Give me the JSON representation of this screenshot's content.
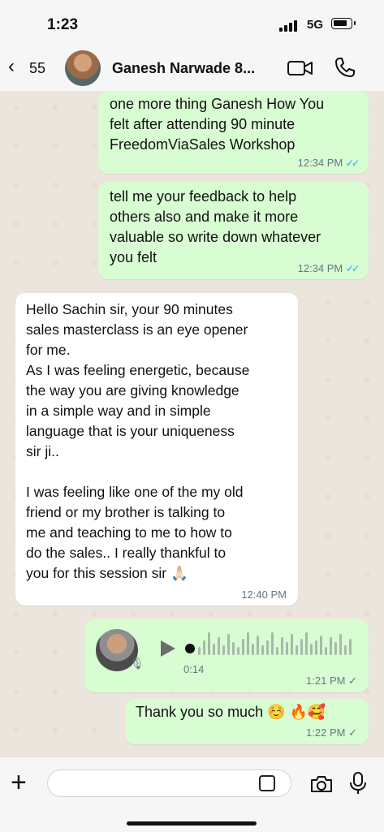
{
  "status": {
    "time": "1:23",
    "network": "5G"
  },
  "header": {
    "back_count": "55",
    "contact": "Ganesh Narwade 8..."
  },
  "messages": [
    {
      "text": "one more thing Ganesh How You\nfelt after attending 90 minute\nFreedomViaSales Workshop",
      "time": "12:34 PM",
      "direction": "out",
      "status": "read"
    },
    {
      "text": "tell me your feedback to help\nothers also and make it more\nvaluable so write down whatever\nyou felt",
      "time": "12:34 PM",
      "direction": "out",
      "status": "read"
    },
    {
      "text": "Hello Sachin sir, your 90 minutes\nsales masterclass is an eye opener\nfor me.\nAs I was feeling energetic, because\nthe way you are giving knowledge\nin a simple way and in simple\nlanguage that is your uniqueness\nsir ji..\n\nI was feeling like one of the my old\nfriend or my brother is talking to\nme and teaching to me to how to\ndo the sales.. I really thankful to\nyou for this session sir 🙏🏻",
      "time": "12:40 PM",
      "direction": "in"
    },
    {
      "type": "voice",
      "duration": "0:14",
      "time": "1:21 PM",
      "direction": "out",
      "status": "delivered"
    },
    {
      "text": "Thank you so much ☺️ 🔥🥰",
      "time": "1:22 PM",
      "direction": "out",
      "status": "delivered"
    }
  ],
  "input": {
    "placeholder": ""
  },
  "icons": {
    "back": "chevron-left-icon",
    "video": "video-camera-icon",
    "call": "phone-icon",
    "attach": "plus-icon",
    "sticker": "sticker-icon",
    "camera": "camera-icon",
    "mic": "microphone-icon"
  },
  "colors": {
    "outgoing": "#d9fdd3",
    "incoming": "#ffffff",
    "read_ticks": "#53bdeb"
  }
}
